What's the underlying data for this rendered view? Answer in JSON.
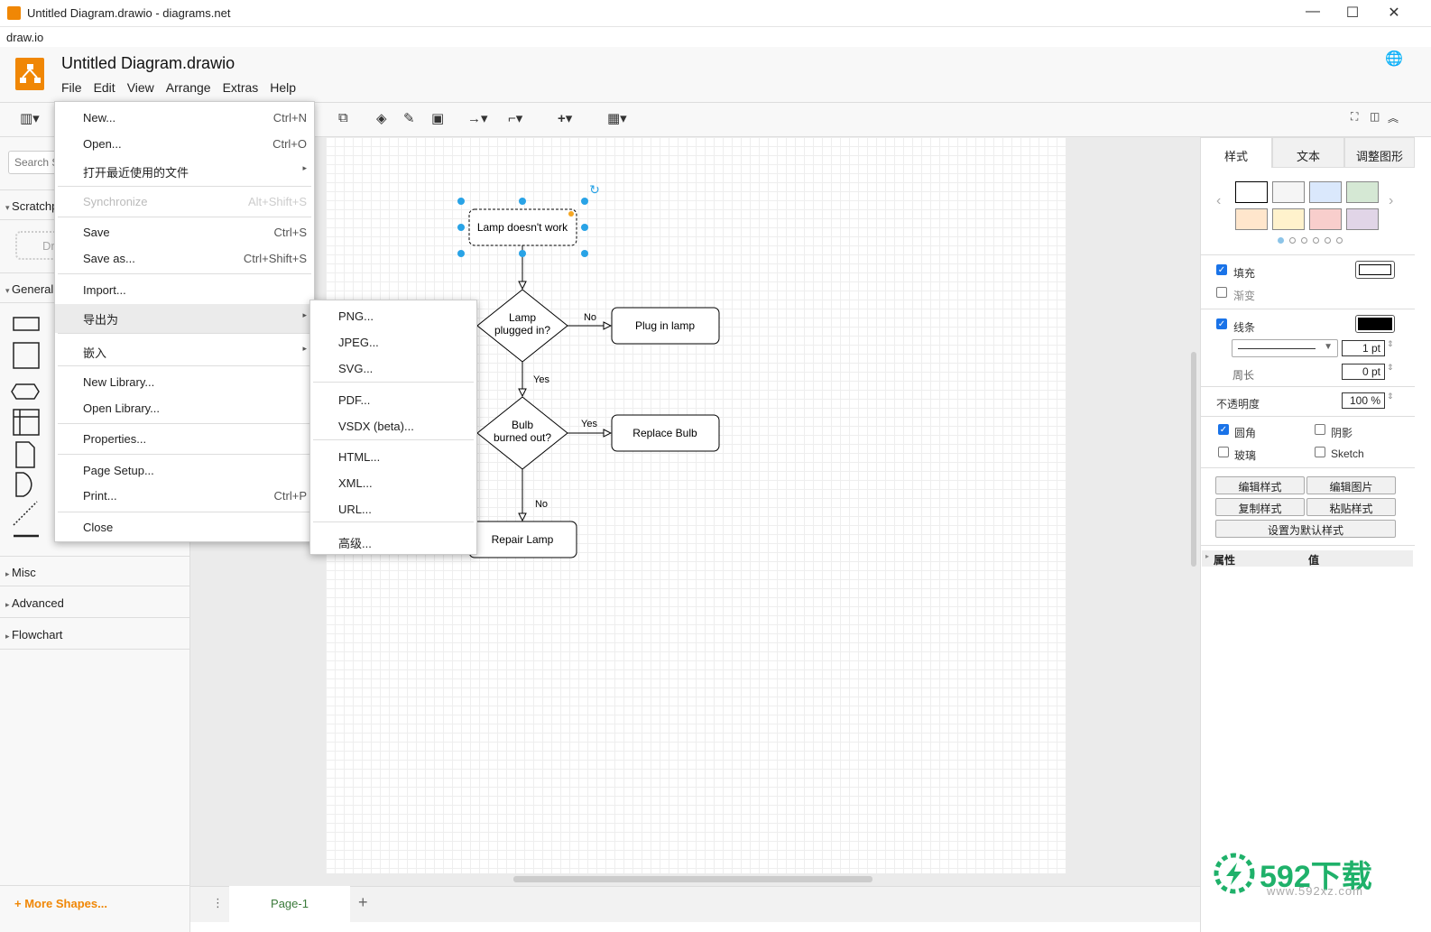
{
  "window": {
    "title": "Untitled Diagram.drawio - diagrams.net",
    "app": "draw.io",
    "minimize": "—",
    "maximize": "☐",
    "close": "✕"
  },
  "header": {
    "doc_title": "Untitled Diagram.drawio",
    "menus": [
      "File",
      "Edit",
      "View",
      "Arrange",
      "Extras",
      "Help"
    ],
    "brand_color": "#f08705"
  },
  "sidebar": {
    "search_placeholder": "Search Shapes",
    "sections": [
      "Scratchpad",
      "General",
      "Misc",
      "Advanced",
      "Flowchart"
    ],
    "scratch_drop": "Drag elements here",
    "more_shapes": "More Shapes..."
  },
  "file_menu": [
    {
      "label": "New...",
      "shortcut": "Ctrl+N"
    },
    {
      "label": "Open...",
      "shortcut": "Ctrl+O"
    },
    {
      "label": "打开最近使用的文件",
      "submenu": true
    },
    {
      "label": "Synchronize",
      "shortcut": "Alt+Shift+S",
      "disabled": true
    },
    {
      "label": "Save",
      "shortcut": "Ctrl+S"
    },
    {
      "label": "Save as...",
      "shortcut": "Ctrl+Shift+S"
    },
    {
      "label": "Import..."
    },
    {
      "label": "导出为",
      "submenu": true,
      "highlighted": true
    },
    {
      "label": "嵌入",
      "submenu": true
    },
    {
      "label": "New Library..."
    },
    {
      "label": "Open Library..."
    },
    {
      "label": "Properties..."
    },
    {
      "label": "Page Setup..."
    },
    {
      "label": "Print...",
      "shortcut": "Ctrl+P"
    },
    {
      "label": "Close"
    }
  ],
  "export_menu": [
    "PNG...",
    "JPEG...",
    "SVG...",
    "PDF...",
    "VSDX (beta)...",
    "HTML...",
    "XML...",
    "URL...",
    "高级..."
  ],
  "diagram": {
    "start": "Lamp doesn't work",
    "d1a": "Lamp",
    "d1b": "plugged in?",
    "plug": "Plug in lamp",
    "d2a": "Bulb",
    "d2b": "burned out?",
    "replace": "Replace Bulb",
    "repair": "Repair Lamp",
    "no1": "No",
    "yes1": "Yes",
    "yes2": "Yes",
    "no2": "No"
  },
  "pages": {
    "current": "Page-1",
    "add": "+"
  },
  "format": {
    "tabs": [
      "样式",
      "文本",
      "调整图形"
    ],
    "swatches": [
      "#ffffff",
      "#f5f5f5",
      "#dae8fc",
      "#d5e8d4",
      "#ffe6cc",
      "#fff2cc",
      "#f8cecc",
      "#e1d5e7"
    ],
    "fill": {
      "label": "填充",
      "checked": true
    },
    "gradient": {
      "label": "渐变",
      "checked": false
    },
    "line": {
      "label": "线条",
      "checked": true,
      "width": "1 pt"
    },
    "perimeter": {
      "label": "周长",
      "value": "0 pt"
    },
    "opacity": {
      "label": "不透明度",
      "value": "100 %"
    },
    "rounded": {
      "label": "圆角",
      "checked": true
    },
    "shadow": {
      "label": "阴影",
      "checked": false
    },
    "glass": {
      "label": "玻璃",
      "checked": false
    },
    "sketch": {
      "label": "Sketch",
      "checked": false
    },
    "buttons": [
      "编辑样式",
      "编辑图片",
      "复制样式",
      "粘贴样式",
      "设置为默认样式"
    ],
    "prop_header": "属性",
    "value_header": "值"
  },
  "watermark": {
    "brand": "592下载",
    "url": "www.592xz.com"
  }
}
